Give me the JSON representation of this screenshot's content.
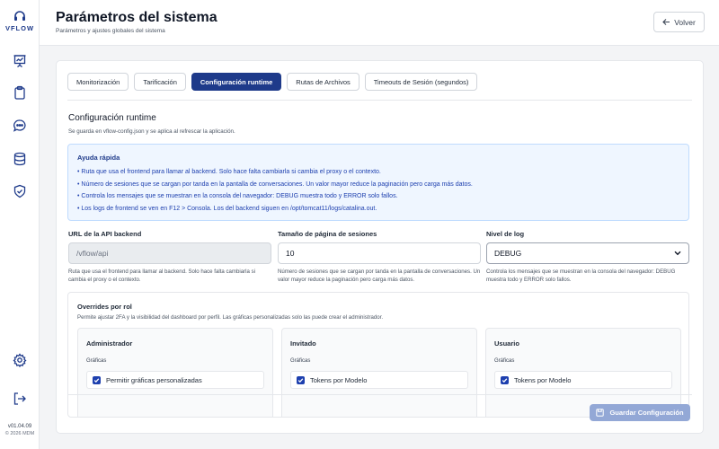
{
  "app": {
    "logo_text": "VFLOW",
    "version": "v01.04.09",
    "copyright": "© 2026 MDM"
  },
  "header": {
    "title": "Parámetros del sistema",
    "subtitle": "Parámetros y ajustes globales del sistema",
    "back_label": "Volver"
  },
  "sidebar": {
    "items": [
      {
        "icon": "presentation-chart-icon"
      },
      {
        "icon": "clipboard-icon"
      },
      {
        "icon": "chat-bubble-icon"
      },
      {
        "icon": "database-icon"
      },
      {
        "icon": "shield-check-icon"
      }
    ],
    "bottom": [
      {
        "icon": "gear-icon"
      },
      {
        "icon": "logout-icon"
      }
    ]
  },
  "tabs": [
    {
      "label": "Monitorización",
      "active": false
    },
    {
      "label": "Tarificación",
      "active": false
    },
    {
      "label": "Configuración runtime",
      "active": true
    },
    {
      "label": "Rutas de Archivos",
      "active": false
    },
    {
      "label": "Timeouts de Sesión (segundos)",
      "active": false
    }
  ],
  "section": {
    "title": "Configuración runtime",
    "description": "Se guarda en vflow-config.json y se aplica al refrescar la aplicación."
  },
  "help": {
    "title": "Ayuda rápida",
    "lines": [
      "• Ruta que usa el frontend para llamar al backend. Solo hace falta cambiarla si cambia el proxy o el contexto.",
      "• Número de sesiones que se cargan por tanda en la pantalla de conversaciones. Un valor mayor reduce la paginación pero carga más datos.",
      "• Controla los mensajes que se muestran en la consola del navegador: DEBUG muestra todo y ERROR solo fallos.",
      "• Los logs de frontend se ven en F12 > Consola. Los del backend siguen en /opt/tomcat11/logs/catalina.out."
    ]
  },
  "fields": {
    "api_url": {
      "label": "URL de la API backend",
      "value": "/vflow/api",
      "help": "Ruta que usa el frontend para llamar al backend. Solo hace falta cambiarla si cambia el proxy o el contexto."
    },
    "page_size": {
      "label": "Tamaño de página de sesiones",
      "value": "10",
      "help": "Número de sesiones que se cargan por tanda en la pantalla de conversaciones. Un valor mayor reduce la paginación pero carga más datos."
    },
    "log_level": {
      "label": "Nivel de log",
      "value": "DEBUG",
      "help": "Controla los mensajes que se muestran en la consola del navegador: DEBUG muestra todo y ERROR solo fallos."
    }
  },
  "overrides": {
    "title": "Overrides por rol",
    "description": "Permite ajustar 2FA y la visibilidad del dashboard por perfil. Las gráficas personalizadas solo las puede crear el administrador.",
    "roles": [
      {
        "name": "Administrador",
        "section_label": "Gráficas",
        "first_item": "Permitir gráficas personalizadas",
        "checked": true
      },
      {
        "name": "Invitado",
        "section_label": "Gráficas",
        "first_item": "Tokens por Modelo",
        "checked": true
      },
      {
        "name": "Usuario",
        "section_label": "Gráficas",
        "first_item": "Tokens por Modelo",
        "checked": true
      }
    ]
  },
  "save_label": "Guardar Configuración",
  "colors": {
    "primary": "#1e3a8a",
    "help_bg": "#eff6ff",
    "save_disabled": "#93a8d6"
  }
}
